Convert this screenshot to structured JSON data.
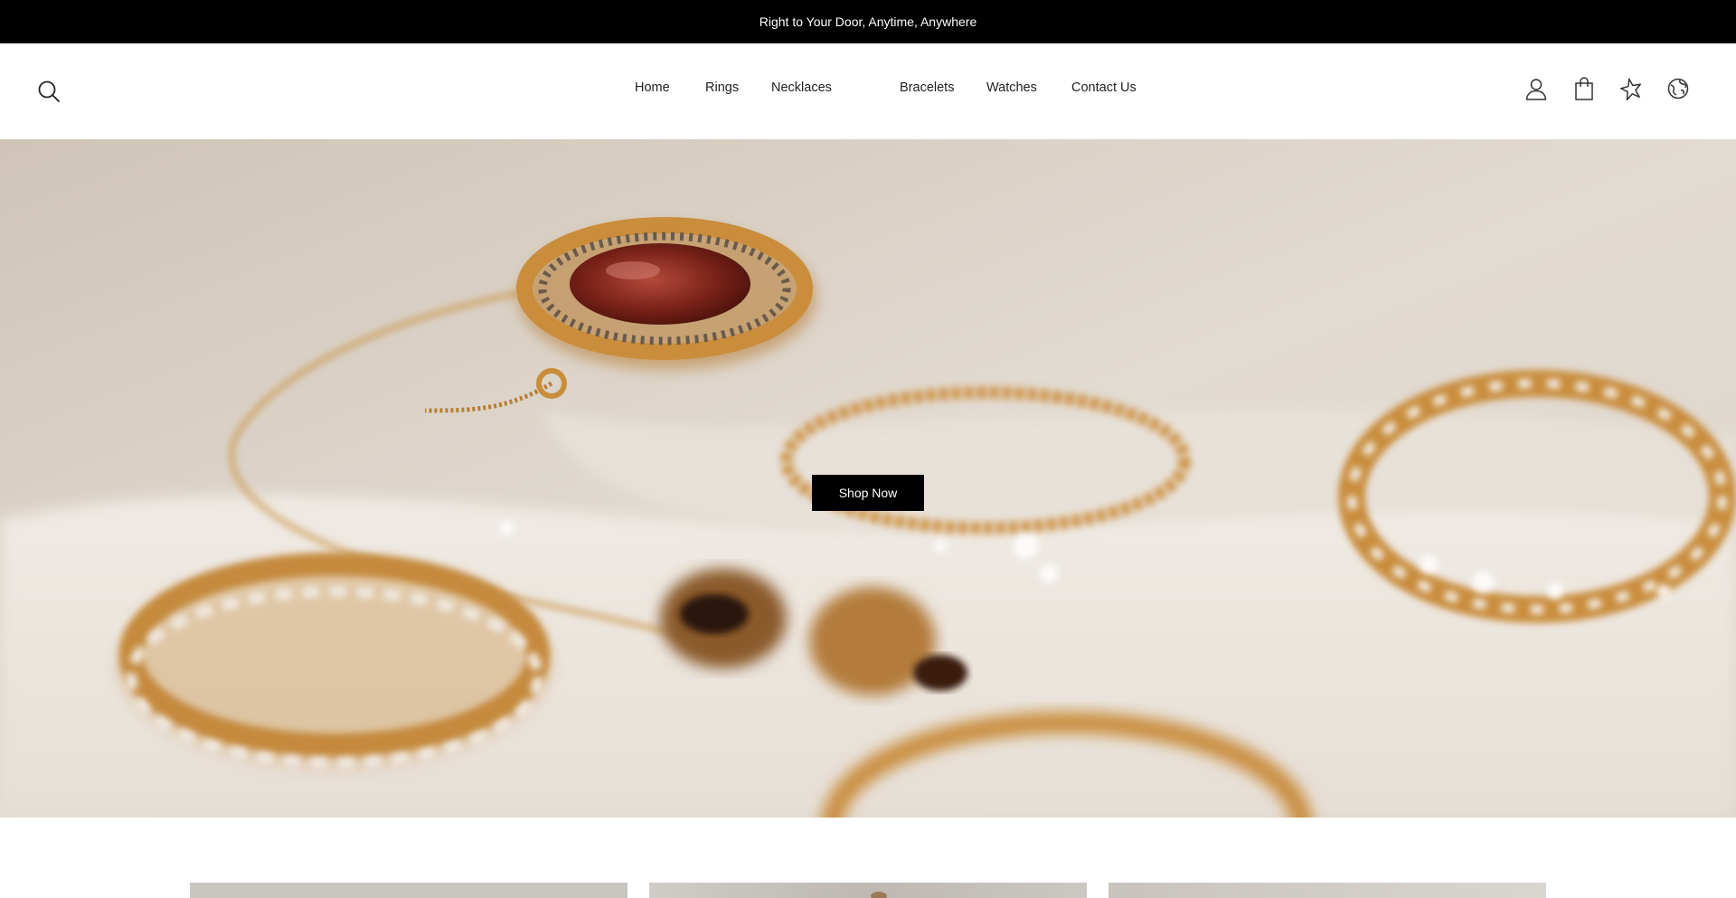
{
  "announcement": {
    "text": "Right to Your Door, Anytime, Anywhere"
  },
  "header": {
    "search_icon": "search-icon",
    "nav": [
      {
        "label": "Home"
      },
      {
        "label": "Rings"
      },
      {
        "label": "Necklaces"
      },
      {
        "label": "Bracelets"
      },
      {
        "label": "Watches"
      },
      {
        "label": "Contact Us"
      }
    ],
    "icons": [
      "account-icon",
      "cart-icon",
      "wishlist-star-icon",
      "globe-language-icon"
    ]
  },
  "hero": {
    "button_label": "Shop Now",
    "image": "gold-jewelry-hero-image"
  },
  "collections": {
    "cards": [
      "collection-card-1",
      "collection-card-2",
      "collection-card-3"
    ]
  },
  "colors": {
    "announcement_bg": "#000000",
    "button_bg": "#000000",
    "gold": "#c98d3c"
  }
}
